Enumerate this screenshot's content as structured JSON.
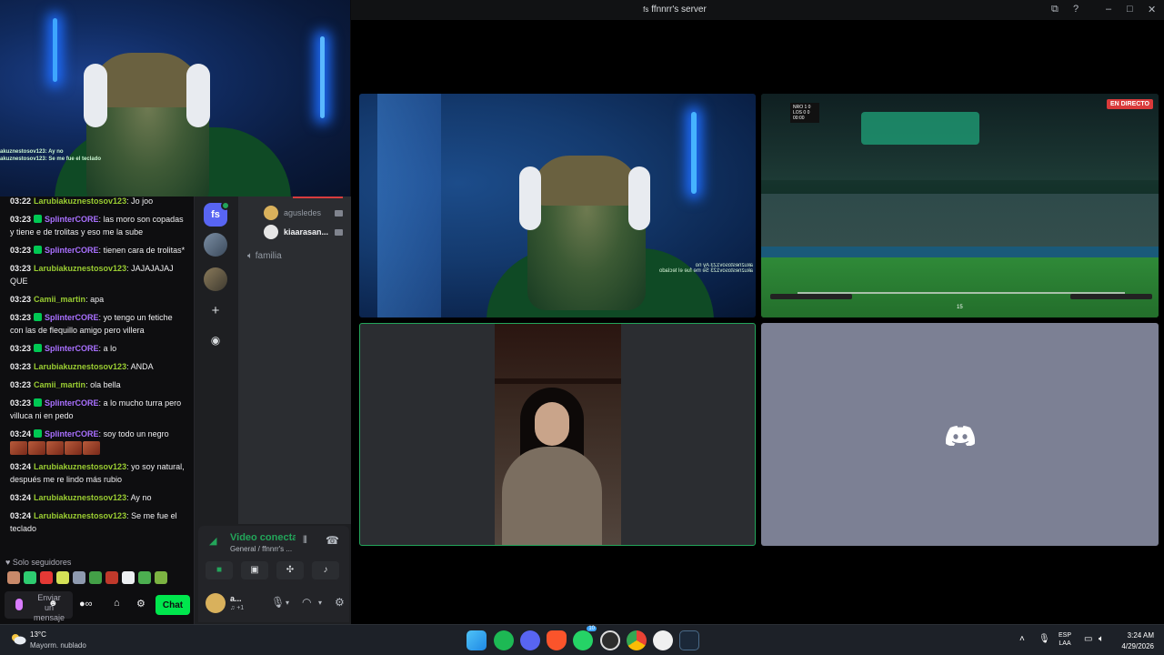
{
  "cam_overlay": {
    "chat_lines": [
      {
        "user": "akuznestosov123:",
        "text": "Ay no"
      },
      {
        "user": "akuznestosov123:",
        "text": "Se me fue el teclado"
      }
    ]
  },
  "twitch_chat": {
    "messages": [
      {
        "time": "03:22",
        "user": "Larubiakuznestosov123",
        "color": "green",
        "badge": false,
        "text": "Jo joo"
      },
      {
        "time": "03:23",
        "user": "SplinterCORE",
        "color": "purple",
        "badge": true,
        "text": "las moro son copadas y tiene e de trolitas y eso me la sube"
      },
      {
        "time": "03:23",
        "user": "SplinterCORE",
        "color": "purple",
        "badge": true,
        "text": "tienen cara de trolitas*"
      },
      {
        "time": "03:23",
        "user": "Larubiakuznestosov123",
        "color": "green",
        "badge": false,
        "text": "JAJAJAJAJ QUE"
      },
      {
        "time": "03:23",
        "user": "Camii_martin",
        "color": "green",
        "badge": false,
        "text": "apa"
      },
      {
        "time": "03:23",
        "user": "SplinterCORE",
        "color": "purple",
        "badge": true,
        "text": "yo tengo un fetiche con las de flequillo amigo pero villera"
      },
      {
        "time": "03:23",
        "user": "SplinterCORE",
        "color": "purple",
        "badge": true,
        "text": "a lo"
      },
      {
        "time": "03:23",
        "user": "Larubiakuznestosov123",
        "color": "green",
        "badge": false,
        "text": "ANDA"
      },
      {
        "time": "03:23",
        "user": "Camii_martin",
        "color": "green",
        "badge": false,
        "text": "ola bella"
      },
      {
        "time": "03:23",
        "user": "SplinterCORE",
        "color": "purple",
        "badge": true,
        "text": "a lo mucho turra pero villuca ni en pedo"
      },
      {
        "time": "03:24",
        "user": "SplinterCORE",
        "color": "purple",
        "badge": true,
        "text": "soy todo un negro",
        "emotes": 5
      },
      {
        "time": "03:24",
        "user": "Larubiakuznestosov123",
        "color": "green",
        "badge": false,
        "text": "yo soy natural, después me re lindo más rubio"
      },
      {
        "time": "03:24",
        "user": "Larubiakuznestosov123",
        "color": "green",
        "badge": false,
        "text": "Ay no"
      },
      {
        "time": "03:24",
        "user": "Larubiakuznestosov123",
        "color": "green",
        "badge": false,
        "text": "Se me fue el teclado"
      }
    ],
    "followers_only": "Solo seguidores",
    "input_placeholder": "Enviar un mensaje",
    "chat_button": "Chat",
    "emote_colors": [
      "#c98a6a",
      "#2ecc71",
      "#e53935",
      "#d4e157",
      "#8e9aaf",
      "#43a047",
      "#c0392b",
      "#eceff1",
      "#4caf50",
      "#7cb342"
    ]
  },
  "discord": {
    "server_badge": "fs",
    "voice_users": [
      {
        "name": "agusledes",
        "muted_text": "♪"
      },
      {
        "name": "kiaarasan..."
      }
    ],
    "voice_channel_name": "familia",
    "voice_status": "Video conectado",
    "voice_location": "General / ffnnrr's ...",
    "user_name": "a...",
    "user_sub": "♫ +1"
  },
  "call_window": {
    "title": "ffnnrr's server",
    "live_badge": "EN DIRECTO",
    "scoreboard": [
      "NRO 1 0",
      "LOS 0 0",
      "00:00"
    ],
    "match_time": "15",
    "cam_caption": [
      "akuznestosov123 Ay no",
      "akuznestosov123 Se me fue el teclado"
    ]
  },
  "taskbar": {
    "temperature": "13°C",
    "weather": "Mayorm. nublado",
    "lang_top": "ESP",
    "lang_bottom": "LAA",
    "time": "3:24 AM",
    "date": "4/29/2026",
    "apps": [
      "file-explorer",
      "spotify",
      "discord",
      "brave",
      "whatsapp",
      "obs",
      "chrome",
      "github",
      "steam"
    ],
    "discord_badge": "10"
  },
  "colors": {
    "twitch_green": "#00e64d",
    "discord_blurple": "#5865f2",
    "discord_green": "#23a55a",
    "username_green": "#9acd32",
    "username_purple": "#a970ff"
  }
}
